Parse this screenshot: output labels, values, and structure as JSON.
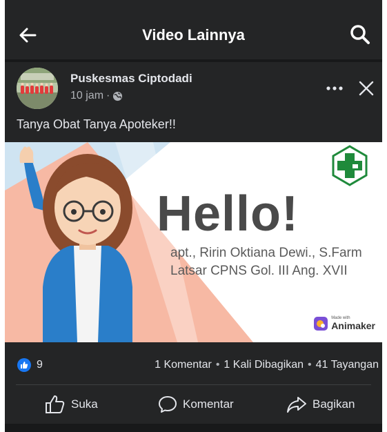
{
  "header": {
    "title": "Video Lainnya"
  },
  "post": {
    "author": "Puskesmas Ciptodadi",
    "time": "10 jam",
    "separator": "·",
    "caption": "Tanya Obat Tanya Apoteker!!",
    "icons": {
      "privacy": "globe-icon",
      "more": "more-dots-icon",
      "close": "close-icon"
    }
  },
  "video": {
    "greeting": "Hello!",
    "name_line": "apt., Ririn Oktiana Dewi., S.Farm",
    "course_line": "Latsar CPNS Gol. III Ang. XVII",
    "watermark_small": "Made with",
    "watermark_brand": "Animaker"
  },
  "reactions": {
    "like_count": "9",
    "comments": "1 Komentar",
    "shares": "1 Kali Dibagikan",
    "views": "41 Tayangan",
    "dot": "•"
  },
  "actions": {
    "like": "Suka",
    "comment": "Komentar",
    "share": "Bagikan"
  },
  "colors": {
    "background": "#242526",
    "text": "#e4e6eb",
    "muted": "#b0b3b8",
    "like_blue": "#1877f2",
    "puskesmas_green": "#1f8a3b",
    "salmon": "#f7b9a4",
    "sky": "#cfe4f2"
  }
}
